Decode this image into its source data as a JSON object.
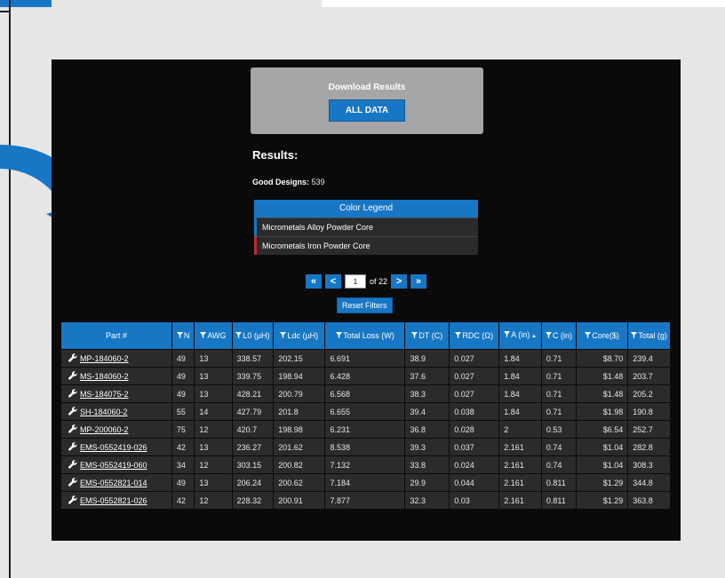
{
  "download": {
    "title": "Download Results",
    "all_data_label": "ALL DATA"
  },
  "results": {
    "title": "Results:",
    "good_designs_label": "Good Designs:",
    "good_designs_count": "539"
  },
  "legend": {
    "title": "Color Legend",
    "items": [
      {
        "label": "Micrometals Alloy Powder Core",
        "color": "#1777c4"
      },
      {
        "label": "Micrometals Iron Powder Core",
        "color": "#c0282d"
      }
    ]
  },
  "pager": {
    "first": "«",
    "prev": "<",
    "current_page": "1",
    "of_text": "of 22",
    "next": ">",
    "last": "»"
  },
  "reset_filters_label": "Reset Filters",
  "table": {
    "headers": [
      {
        "label": "Part #",
        "filter": false
      },
      {
        "label": "N",
        "filter": true
      },
      {
        "label": "AWG",
        "filter": true
      },
      {
        "label": "L0 (µH)",
        "filter": true
      },
      {
        "label": "Ldc (µH)",
        "filter": true
      },
      {
        "label": "Total Loss (W)",
        "filter": true
      },
      {
        "label": "DT (C)",
        "filter": true
      },
      {
        "label": "RDC (Ω)",
        "filter": true
      },
      {
        "label": "A (in)",
        "filter": true,
        "sorted": "asc"
      },
      {
        "label": "C (in)",
        "filter": true
      },
      {
        "label": "Core($)",
        "filter": true
      },
      {
        "label": "Total (g)",
        "filter": true
      }
    ],
    "rows": [
      [
        "MP-184060-2",
        "49",
        "13",
        "338.57",
        "202.15",
        "6.691",
        "38.9",
        "0.027",
        "1.84",
        "0.71",
        "$8.70",
        "239.4"
      ],
      [
        "MS-184060-2",
        "49",
        "13",
        "339.75",
        "198.94",
        "6.428",
        "37.6",
        "0.027",
        "1.84",
        "0.71",
        "$1.48",
        "203.7"
      ],
      [
        "MS-184075-2",
        "49",
        "13",
        "428.21",
        "200.79",
        "6.568",
        "38.3",
        "0.027",
        "1.84",
        "0.71",
        "$1.48",
        "205.2"
      ],
      [
        "SH-184060-2",
        "55",
        "14",
        "427.79",
        "201.8",
        "6.655",
        "39.4",
        "0.038",
        "1.84",
        "0.71",
        "$1.98",
        "190.8"
      ],
      [
        "MP-200060-2",
        "75",
        "12",
        "420.7",
        "198.98",
        "6.231",
        "36.8",
        "0.028",
        "2",
        "0.53",
        "$6.54",
        "252.7"
      ],
      [
        "EMS-0552419-026",
        "42",
        "13",
        "236.27",
        "201.62",
        "8.538",
        "39.3",
        "0.037",
        "2.161",
        "0.74",
        "$1.04",
        "282.8"
      ],
      [
        "EMS-0552419-060",
        "34",
        "12",
        "303.15",
        "200.82",
        "7.132",
        "33.8",
        "0.024",
        "2.161",
        "0.74",
        "$1.04",
        "308.3"
      ],
      [
        "EMS-0552821-014",
        "49",
        "13",
        "206.24",
        "200.62",
        "7.184",
        "29.9",
        "0.044",
        "2.161",
        "0.811",
        "$1.29",
        "344.8"
      ],
      [
        "EMS-0552821-026",
        "42",
        "12",
        "228.32",
        "200.91",
        "7.877",
        "32.3",
        "0.03",
        "2.161",
        "0.811",
        "$1.29",
        "363.8"
      ]
    ]
  }
}
